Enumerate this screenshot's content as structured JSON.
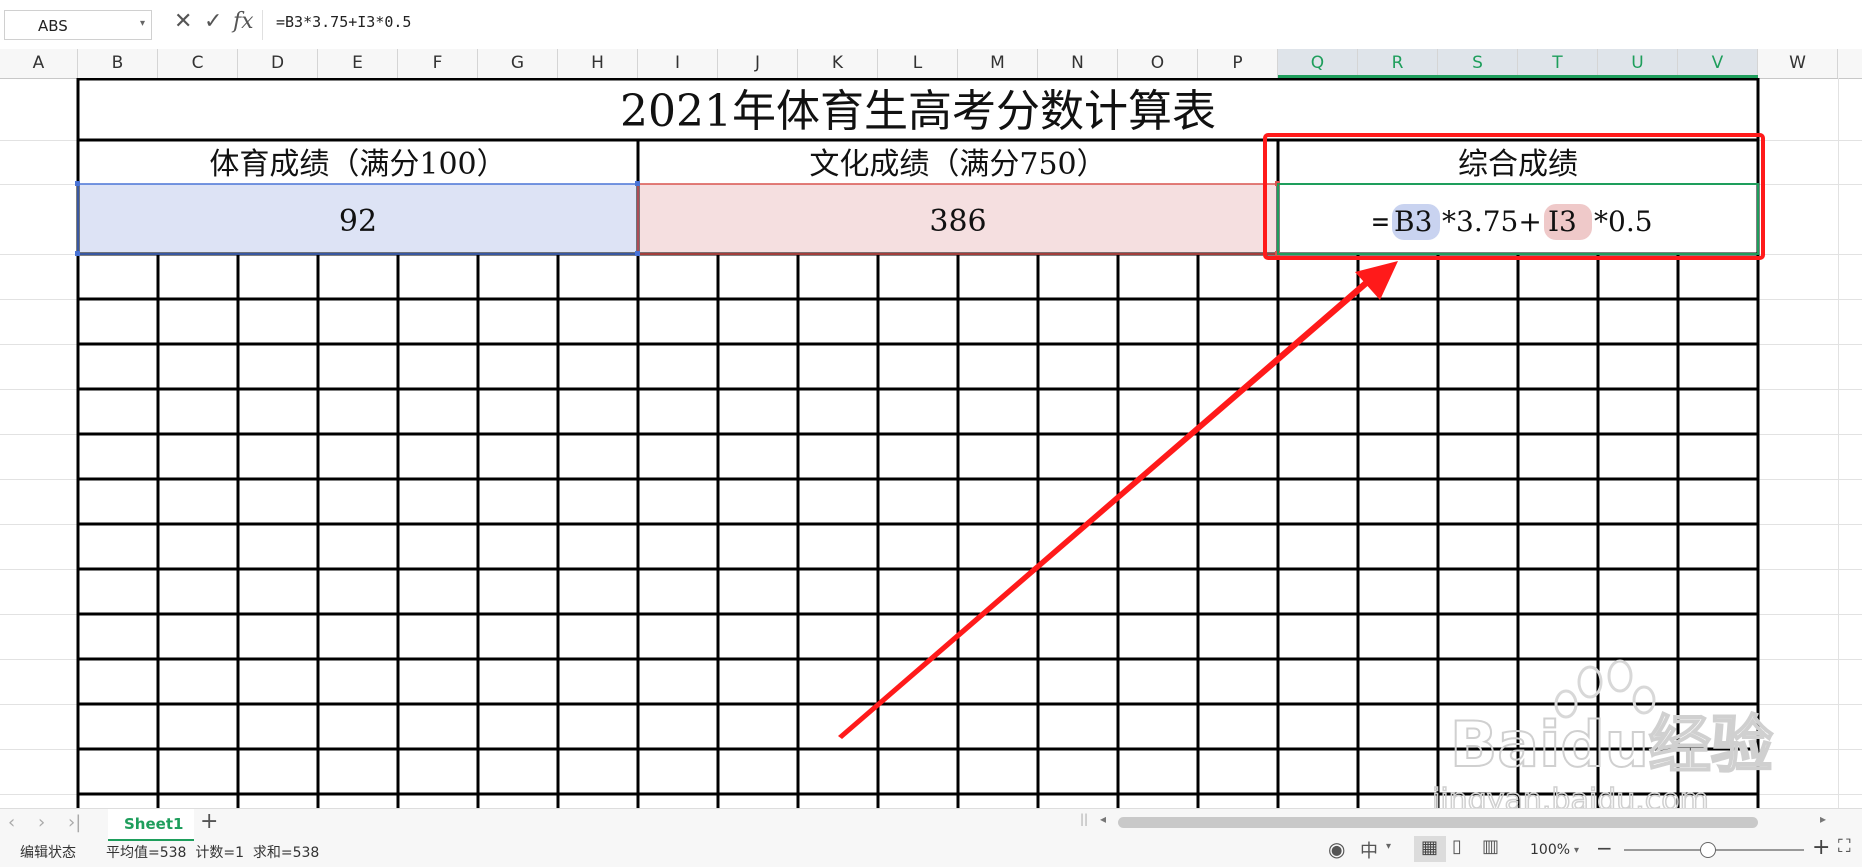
{
  "formula_bar": {
    "name_box": "ABS",
    "cancel_icon": "✕",
    "confirm_icon": "✓",
    "fx_label": "fx",
    "formula": "=B3*3.75+I3*0.5"
  },
  "columns": [
    "A",
    "B",
    "C",
    "D",
    "E",
    "F",
    "G",
    "H",
    "I",
    "J",
    "K",
    "L",
    "M",
    "N",
    "O",
    "P",
    "Q",
    "R",
    "S",
    "T",
    "U",
    "V",
    "W"
  ],
  "sheet": {
    "title": "2021年体育生高考分数计算表",
    "sports_header": "体育成绩（满分100）",
    "culture_header": "文化成绩（满分750）",
    "total_header": "综合成绩",
    "sports_score": "92",
    "culture_score": "386",
    "formula_parts": {
      "eq": "=",
      "ref1": "B3",
      "mid": "*3.75+",
      "ref2": "I3",
      "tail": "*0.5"
    }
  },
  "tabs": {
    "sheet1": "Sheet1",
    "add": "+"
  },
  "status": {
    "mode": "编辑状态",
    "stats": "平均值=538  计数=1  求和=538",
    "zoom": "100%"
  },
  "watermark": {
    "line1": "Baidu经验",
    "line2": "jingyan.baidu.com"
  },
  "colors": {
    "accent_green": "#1e9e5c",
    "ref_blue": "#dde3f5",
    "ref_red": "#f5dfe0",
    "highlight_red": "#ff1a1a"
  }
}
